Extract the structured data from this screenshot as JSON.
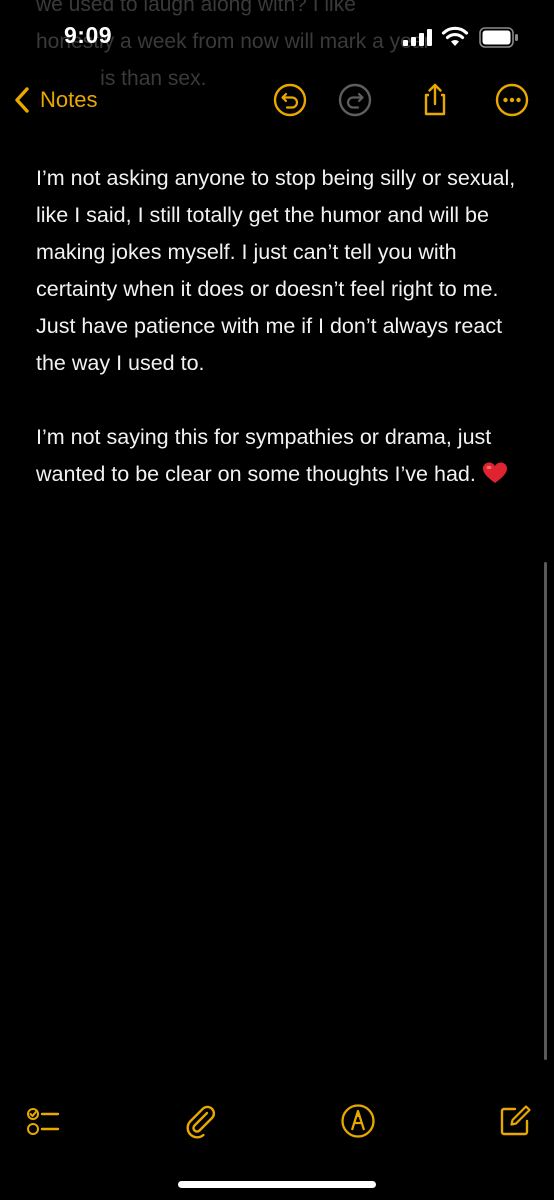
{
  "status_bar": {
    "time": "9:09"
  },
  "ghost_text": {
    "lines": [
      "we used to laugh along with? I like",
      "honestly a week from now will mark a year",
      "           is than sex."
    ]
  },
  "nav": {
    "back_label": "Notes",
    "back_icon": "chevron-left-icon",
    "undo_icon": "undo-icon",
    "redo_icon": "redo-icon",
    "share_icon": "share-icon",
    "more_icon": "ellipsis-circle-icon"
  },
  "note": {
    "paragraph_1": "I’m not asking anyone to stop being silly or sexual, like I said, I still totally get the humor and will be making jokes myself. I just can’t tell you with certainty when it does or doesn’t feel right to me. Just have patience with me if I don’t always react the way I used to.",
    "paragraph_2_text": "I’m not saying this for sympathies or drama, just wanted to be clear on some thoughts I’ve had. ",
    "paragraph_2_emoji": "heart-emoji"
  },
  "toolbar": {
    "checklist_icon": "checklist-icon",
    "attachment_icon": "paperclip-icon",
    "markup_icon": "markup-pen-icon",
    "compose_icon": "compose-icon"
  },
  "colors": {
    "accent": "#e9a800",
    "background": "#000000",
    "text": "#f2f2f2"
  }
}
